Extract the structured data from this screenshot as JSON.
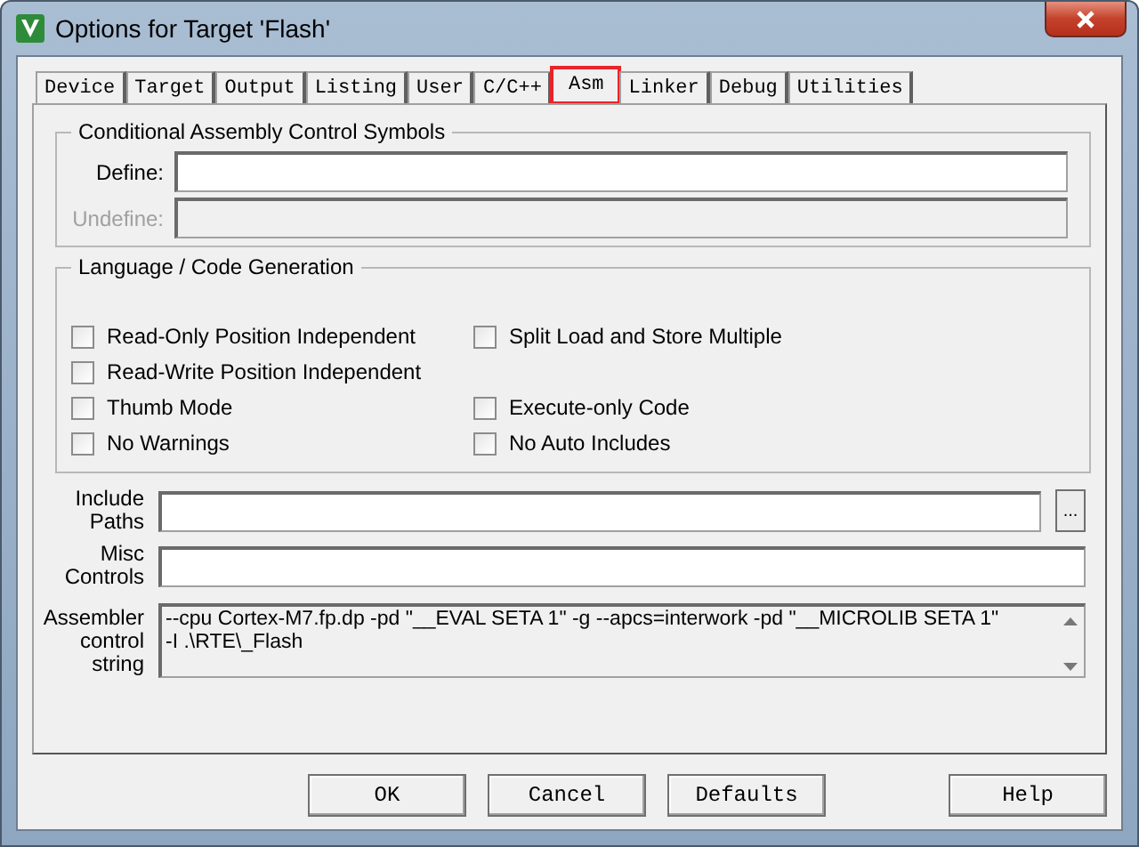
{
  "window": {
    "title": "Options for Target 'Flash'"
  },
  "tabs": [
    {
      "label": "Device",
      "selected": false,
      "highlighted": false
    },
    {
      "label": "Target",
      "selected": false,
      "highlighted": false
    },
    {
      "label": "Output",
      "selected": false,
      "highlighted": false
    },
    {
      "label": "Listing",
      "selected": false,
      "highlighted": false
    },
    {
      "label": "User",
      "selected": false,
      "highlighted": false
    },
    {
      "label": "C/C++",
      "selected": false,
      "highlighted": false
    },
    {
      "label": "Asm",
      "selected": true,
      "highlighted": true
    },
    {
      "label": "Linker",
      "selected": false,
      "highlighted": false
    },
    {
      "label": "Debug",
      "selected": false,
      "highlighted": false
    },
    {
      "label": "Utilities",
      "selected": false,
      "highlighted": false
    }
  ],
  "conditional_group": {
    "title": "Conditional Assembly Control Symbols",
    "fields": [
      {
        "label": "Define:",
        "disabled": false
      },
      {
        "label": "Undefine:",
        "disabled": true
      }
    ]
  },
  "language_group": {
    "title": "Language / Code Generation",
    "rows": [
      [
        {
          "label": "Read-Only Position Independent",
          "checked": false
        },
        {
          "label": "Split Load and Store Multiple",
          "checked": false
        }
      ],
      [
        {
          "label": "Read-Write Position Independent",
          "checked": false
        }
      ],
      [
        {
          "label": "Thumb Mode",
          "checked": false
        },
        {
          "label": "Execute-only Code",
          "checked": false
        }
      ],
      [
        {
          "label": "No Warnings",
          "checked": false
        },
        {
          "label": "No Auto Includes",
          "checked": false
        }
      ]
    ]
  },
  "include_paths": {
    "label": [
      "Include",
      "Paths"
    ],
    "browse": "..."
  },
  "misc_controls": {
    "label": [
      "Misc",
      "Controls"
    ]
  },
  "assembler_control_string": {
    "label": [
      "Assembler",
      "control",
      "string"
    ],
    "lines": [
      "--cpu Cortex-M7.fp.dp -pd \"__EVAL SETA 1\" -g --apcs=interwork -pd \"__MICROLIB SETA 1\"",
      "-I .\\RTE\\_Flash"
    ]
  },
  "buttons": [
    "OK",
    "Cancel",
    "Defaults",
    "Help"
  ]
}
